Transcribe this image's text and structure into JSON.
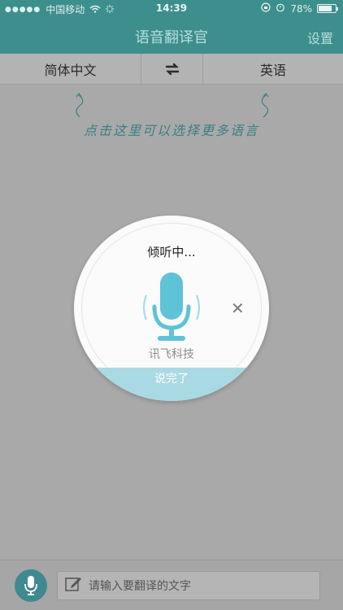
{
  "status": {
    "signal_dots": "●●●●●",
    "carrier": "中国移动",
    "time": "14:39",
    "battery": "78%",
    "battery_level": 0.78
  },
  "header": {
    "title": "语音翻译官",
    "settings": "设置"
  },
  "languages": {
    "source": "简体中文",
    "target": "英语",
    "swap_icon": "swap-arrows-icon"
  },
  "hint": "点击这里可以选择更多语言",
  "dialog": {
    "title": "倾听中...",
    "brand": "讯飞科技",
    "done_button": "说完了",
    "close_icon": "close-icon",
    "accent": "#5ec3d6"
  },
  "bottom": {
    "placeholder": "请输入要翻译的文字"
  }
}
